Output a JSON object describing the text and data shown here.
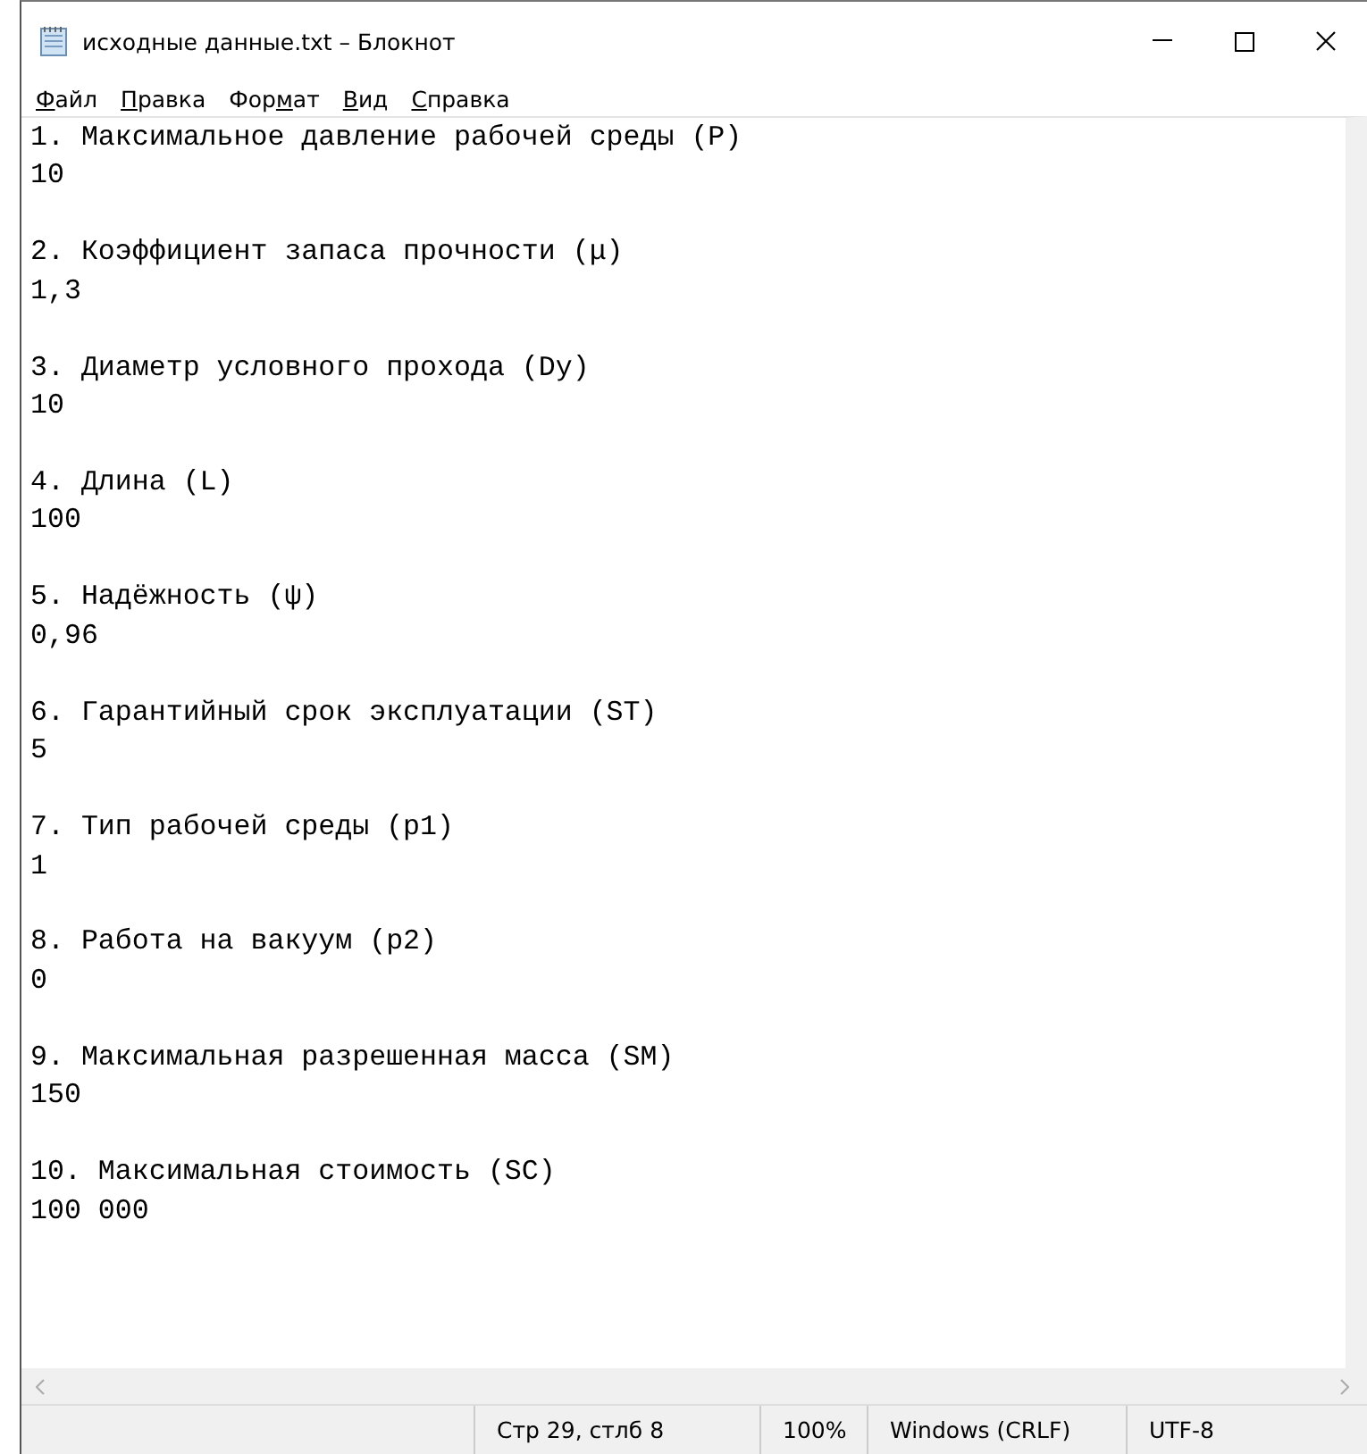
{
  "window": {
    "title": "исходные данные.txt – Блокнот"
  },
  "menu": [
    {
      "key": "Ф",
      "post": "айл"
    },
    {
      "key": "П",
      "post": "равка"
    },
    {
      "pre": "Фор",
      "key": "м",
      "post": "ат"
    },
    {
      "key": "В",
      "post": "ид"
    },
    {
      "key": "С",
      "post": "правка"
    }
  ],
  "lines": [
    {
      "label": "1. Максимальное давление рабочей среды (P)",
      "value": "10"
    },
    {
      "label": "2. Коэффициент запаса прочности (μ)",
      "value": "1,3"
    },
    {
      "label": "3. Диаметр условного прохода (Dy)",
      "value": "10"
    },
    {
      "label": "4. Длина (L)",
      "value": "100"
    },
    {
      "label": "5. Надёжность (ψ)",
      "value": "0,96"
    },
    {
      "label": "6. Гарантийный срок эксплуатации (ST)",
      "value": "5"
    },
    {
      "label": "7. Тип рабочей среды (p1)",
      "value": "1"
    },
    {
      "label": "8. Работа на вакуум (p2)",
      "value": "0"
    },
    {
      "label": "9. Максимальная разрешенная масса (SM)",
      "value": "150"
    },
    {
      "label": "10. Максимальная стоимость (SC)",
      "value": "100 000"
    }
  ],
  "status_bar": {
    "position": "Стр 29, стлб 8",
    "zoom": "100%",
    "line_endings": "Windows (CRLF)",
    "encoding": "UTF-8"
  }
}
